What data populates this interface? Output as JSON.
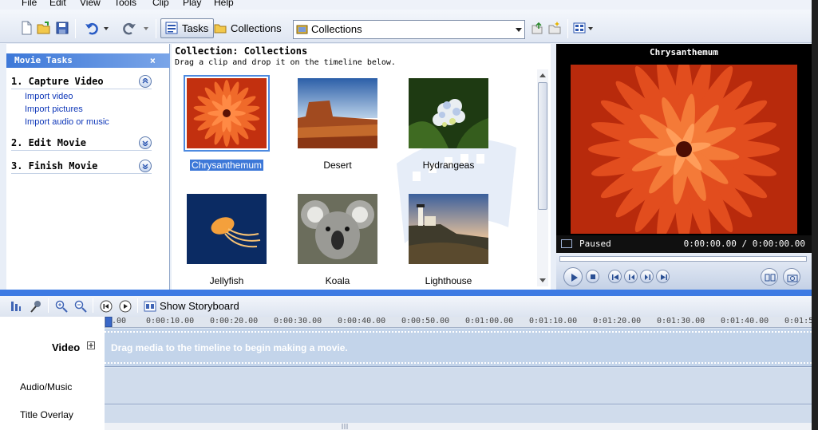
{
  "menu": [
    "File",
    "Edit",
    "View",
    "Tools",
    "Clip",
    "Play",
    "Help"
  ],
  "toolbar": {
    "tasks_label": "Tasks",
    "collections_label": "Collections",
    "collection_select_value": "Collections"
  },
  "task_pane": {
    "header": "Movie Tasks",
    "close": "×",
    "sections": [
      {
        "label": "1. Capture Video",
        "expanded": true,
        "links": [
          "Import video",
          "Import pictures",
          "Import audio or music"
        ]
      },
      {
        "label": "2. Edit Movie",
        "expanded": false
      },
      {
        "label": "3. Finish Movie",
        "expanded": false
      }
    ]
  },
  "collection": {
    "title": "Collection: Collections",
    "subtitle": "Drag a clip and drop it on the timeline below.",
    "clips": [
      "Chrysanthemum",
      "Desert",
      "Hydrangeas",
      "Jellyfish",
      "Koala",
      "Lighthouse"
    ],
    "selected": "Chrysanthemum"
  },
  "preview": {
    "title": "Chrysanthemum",
    "status": "Paused",
    "time": "0:00:00.00 / 0:00:00.00"
  },
  "timeline": {
    "storyboard_label": "Show Storyboard",
    "ruler": [
      ".00",
      "0:00:10.00",
      "0:00:20.00",
      "0:00:30.00",
      "0:00:40.00",
      "0:00:50.00",
      "0:01:00.00",
      "0:01:10.00",
      "0:01:20.00",
      "0:01:30.00",
      "0:01:40.00",
      "0:01:5"
    ],
    "tracks": {
      "video": "Video",
      "audio": "Audio/Music",
      "overlay": "Title Overlay"
    },
    "drag_hint": "Drag media to the timeline to begin making a movie."
  },
  "colors": {
    "accent": "#3d7ae3",
    "link": "#0d36b8",
    "chrysanthemum": "#e2461a"
  }
}
